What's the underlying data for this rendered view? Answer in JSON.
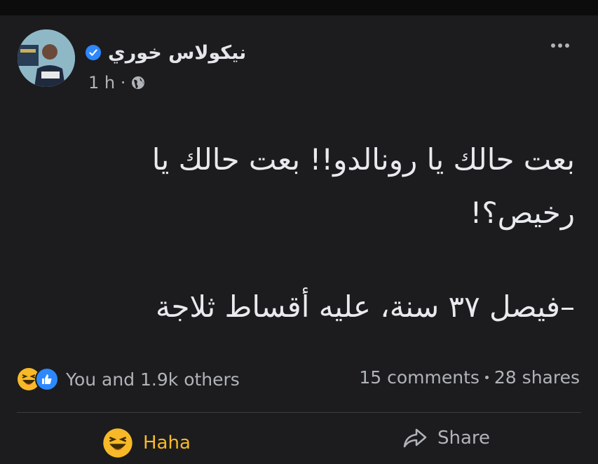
{
  "post": {
    "author_name": "نيكولاس خوري",
    "timestamp": "1 h ·",
    "body_line1": "بعت حالك يا رونالدو!! بعت حالك يا رخيص؟!",
    "body_line2": "–فيصل ٣٧ سنة، عليه أقساط ثلاجة",
    "reactions_text": "You and 1.9k others",
    "comments": "15 comments",
    "shares": "28 shares"
  },
  "actions": {
    "reaction_label": "Haha",
    "share_label": "Share"
  },
  "icons": {
    "verified": "verified-badge-icon",
    "privacy": "globe-icon",
    "more": "more-options-icon",
    "haha": "haha-emoji-icon",
    "like": "like-thumb-icon",
    "share": "share-arrow-icon"
  },
  "colors": {
    "background": "#1c1c1e",
    "text": "#e4e6eb",
    "secondary_text": "#b0b3b8",
    "verified_blue": "#2d88ff",
    "haha_yellow": "#f7b928"
  }
}
